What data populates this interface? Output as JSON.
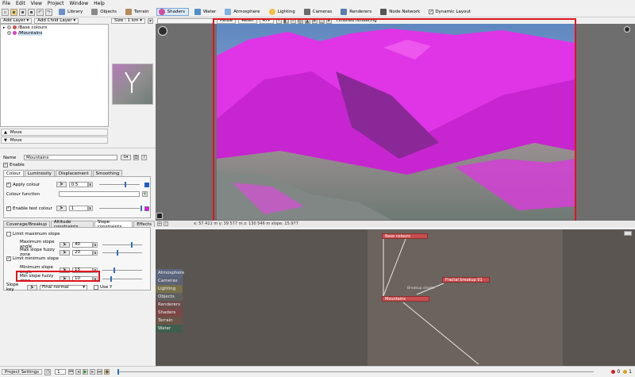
{
  "menu": [
    "File",
    "Edit",
    "View",
    "Project",
    "Window",
    "Help"
  ],
  "toolbar": {
    "buttons": [
      {
        "label": "Library",
        "color": "#6d8fc7"
      },
      {
        "label": "Objects",
        "color": "#8a8a8a"
      },
      {
        "label": "Terrain",
        "color": "#b58b5a"
      },
      {
        "label": "Shaders",
        "color": "#d04fa0"
      },
      {
        "label": "Water",
        "color": "#4f8fd0"
      },
      {
        "label": "Atmosphere",
        "color": "#7fb0e0"
      },
      {
        "label": "Lighting",
        "color": "#f0c040"
      },
      {
        "label": "Cameras",
        "color": "#6b6b6b"
      },
      {
        "label": "Renderers",
        "color": "#5a7fb0"
      },
      {
        "label": "Node Network",
        "color": "#555555"
      }
    ],
    "dynamic_layout": "Dynamic Layout"
  },
  "layers": {
    "add_layer": "Add Layer",
    "add_child_layer": "Add Child Layer",
    "items": [
      "/Base colours",
      "/Mountains"
    ]
  },
  "preview": {
    "size_label": "Size : 1 km"
  },
  "move": {
    "up": "Move",
    "down": "Move"
  },
  "settings": {
    "name_label": "Name",
    "name_value": "Mountains",
    "enable_label": "Enable",
    "tabs": [
      "Colour",
      "Luminosity",
      "Displacement",
      "Smoothing"
    ],
    "apply_colour": "Apply colour",
    "apply_colour_value": "0.5",
    "colour_function": "Colour function",
    "enable_test_colour": "Enable test colour",
    "test_colour_value": "1",
    "subtabs": [
      "Coverage/Breakup",
      "Altitude constraints",
      "Slope constraints",
      "Effects"
    ],
    "limit_max_slope": "Limit maximum slope",
    "max_slope_angle": "Maximum slope angle",
    "max_slope_angle_value": "40",
    "max_slope_fuzzy": "Max slope fuzzy zone",
    "max_slope_fuzzy_value": "20",
    "limit_min_slope": "Limit minimum slope",
    "min_slope_angle": "Minimum slope angle",
    "min_slope_angle_value": "15",
    "min_slope_fuzzy": "Min slope fuzzy zone",
    "min_slope_fuzzy_value": "10",
    "slope_key": "Slope key",
    "slope_key_value": "Final normal",
    "use_y": "Use Y"
  },
  "view": {
    "pause": "Pause",
    "reset": "Reset",
    "rtp": "RTP",
    "status": "Finished rendering",
    "footer": "x: 57 411 m   y: 39 577 m   z: 130 546 m   slope: 15.977"
  },
  "nodes": {
    "items": [
      {
        "label": "Base colours"
      },
      {
        "label": "Fractal breakup 01"
      },
      {
        "label": "Mountains"
      }
    ],
    "wire_label": "Breakup shader",
    "categories": [
      {
        "label": "Atmosphere",
        "color": "#5c6680"
      },
      {
        "label": "Cameras",
        "color": "#5c6277"
      },
      {
        "label": "Lighting",
        "color": "#77704a"
      },
      {
        "label": "Objects",
        "color": "#5f5f5f"
      },
      {
        "label": "Renderers",
        "color": "#6c4c4a"
      },
      {
        "label": "Shaders",
        "color": "#7a4746"
      },
      {
        "label": "Terrain",
        "color": "#6a5446"
      },
      {
        "label": "Water",
        "color": "#3f5e4d"
      }
    ]
  },
  "bottom": {
    "project_settings": "Project Settings",
    "frame": "1",
    "errors": "0",
    "warnings": "1"
  }
}
